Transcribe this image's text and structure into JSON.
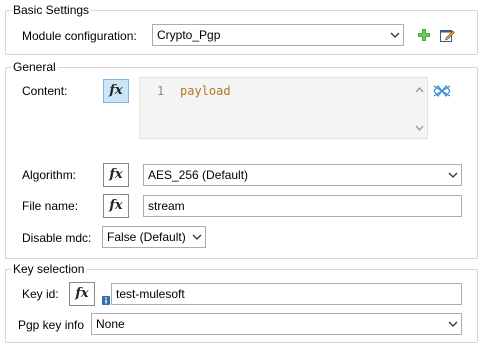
{
  "basic_settings": {
    "title": "Basic Settings",
    "module_config_label": "Module configuration:",
    "module_config_value": "Crypto_Pgp",
    "add_icon": "plus-icon",
    "edit_icon": "edit-icon"
  },
  "general": {
    "title": "General",
    "content_label": "Content:",
    "content_line_number": "1",
    "content_value": "payload",
    "algorithm_label": "Algorithm:",
    "algorithm_value": "AES_256 (Default)",
    "file_name_label": "File name:",
    "file_name_value": "stream",
    "disable_mdc_label": "Disable mdc:",
    "disable_mdc_value": "False (Default)"
  },
  "key_selection": {
    "title": "Key selection",
    "key_id_label": "Key id:",
    "key_id_value": "test-mulesoft",
    "pgp_key_info_label": "Pgp key info",
    "pgp_key_info_value": "None"
  },
  "fx_label": "fx",
  "colors": {
    "accent_green": "#3aa53a",
    "code_text": "#b5781c",
    "fx_active_bg": "#cde6f7"
  }
}
